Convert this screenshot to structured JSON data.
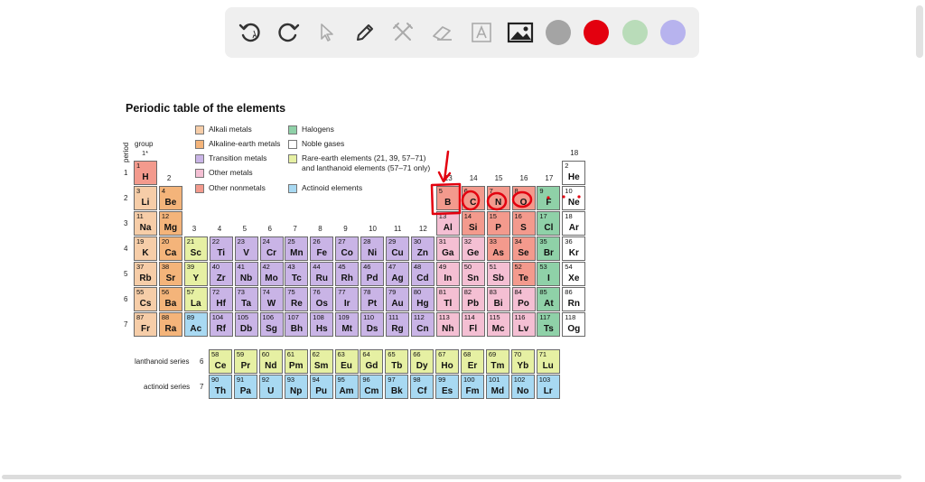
{
  "toolbar": {
    "tools": [
      {
        "name": "undo-icon"
      },
      {
        "name": "redo-icon"
      },
      {
        "name": "select-cursor-icon"
      },
      {
        "name": "pen-icon"
      },
      {
        "name": "tools-icon"
      },
      {
        "name": "eraser-icon"
      },
      {
        "name": "text-icon"
      },
      {
        "name": "image-icon"
      }
    ],
    "colors": [
      "#a4a4a4",
      "#e3000f",
      "#b9dcb9",
      "#b7b3ee"
    ]
  },
  "table": {
    "title": "Periodic table of the elements",
    "period_label": "period",
    "group_label": "group",
    "group1_label": "1*",
    "lanthanoid_label": "lanthanoid series",
    "actinoid_label": "actinoid series",
    "period6_label": "6",
    "period7_label": "7",
    "groups": [
      "1",
      "2",
      "3",
      "4",
      "5",
      "6",
      "7",
      "8",
      "9",
      "10",
      "11",
      "12",
      "13",
      "14",
      "15",
      "16",
      "17",
      "18"
    ],
    "periods": [
      "1",
      "2",
      "3",
      "4",
      "5",
      "6",
      "7"
    ],
    "legend": [
      {
        "label": "Alkali metals",
        "cls": "alkali"
      },
      {
        "label": "Alkaline-earth metals",
        "cls": "alkaline"
      },
      {
        "label": "Transition metals",
        "cls": "transition"
      },
      {
        "label": "Other metals",
        "cls": "other-metal"
      },
      {
        "label": "Other nonmetals",
        "cls": "nonmetal"
      },
      {
        "label": "Halogens",
        "cls": "halogen"
      },
      {
        "label": "Noble gases",
        "cls": "noble"
      },
      {
        "label": "Rare-earth elements (21, 39, 57–71)",
        "label2": "and lanthanoid elements (57–71 only)",
        "cls": "rare"
      },
      {
        "label": "Actinoid elements",
        "cls": "actinoid"
      }
    ],
    "elements": [
      [
        "1",
        "H",
        "nonmetal",
        1,
        1
      ],
      [
        "2",
        "He",
        "noble",
        1,
        18
      ],
      [
        "3",
        "Li",
        "alkali",
        2,
        1
      ],
      [
        "4",
        "Be",
        "alkaline",
        2,
        2
      ],
      [
        "5",
        "B",
        "nonmetal",
        2,
        13
      ],
      [
        "6",
        "C",
        "nonmetal",
        2,
        14
      ],
      [
        "7",
        "N",
        "nonmetal",
        2,
        15
      ],
      [
        "8",
        "O",
        "nonmetal",
        2,
        16
      ],
      [
        "9",
        "F",
        "halogen",
        2,
        17
      ],
      [
        "10",
        "Ne",
        "noble",
        2,
        18
      ],
      [
        "11",
        "Na",
        "alkali",
        3,
        1
      ],
      [
        "12",
        "Mg",
        "alkaline",
        3,
        2
      ],
      [
        "13",
        "Al",
        "other-metal",
        3,
        13
      ],
      [
        "14",
        "Si",
        "nonmetal",
        3,
        14
      ],
      [
        "15",
        "P",
        "nonmetal",
        3,
        15
      ],
      [
        "16",
        "S",
        "nonmetal",
        3,
        16
      ],
      [
        "17",
        "Cl",
        "halogen",
        3,
        17
      ],
      [
        "18",
        "Ar",
        "noble",
        3,
        18
      ],
      [
        "19",
        "K",
        "alkali",
        4,
        1
      ],
      [
        "20",
        "Ca",
        "alkaline",
        4,
        2
      ],
      [
        "21",
        "Sc",
        "rare",
        4,
        3
      ],
      [
        "22",
        "Ti",
        "transition",
        4,
        4
      ],
      [
        "23",
        "V",
        "transition",
        4,
        5
      ],
      [
        "24",
        "Cr",
        "transition",
        4,
        6
      ],
      [
        "25",
        "Mn",
        "transition",
        4,
        7
      ],
      [
        "26",
        "Fe",
        "transition",
        4,
        8
      ],
      [
        "27",
        "Co",
        "transition",
        4,
        9
      ],
      [
        "28",
        "Ni",
        "transition",
        4,
        10
      ],
      [
        "29",
        "Cu",
        "transition",
        4,
        11
      ],
      [
        "30",
        "Zn",
        "transition",
        4,
        12
      ],
      [
        "31",
        "Ga",
        "other-metal",
        4,
        13
      ],
      [
        "32",
        "Ge",
        "other-metal",
        4,
        14
      ],
      [
        "33",
        "As",
        "nonmetal",
        4,
        15
      ],
      [
        "34",
        "Se",
        "nonmetal",
        4,
        16
      ],
      [
        "35",
        "Br",
        "halogen",
        4,
        17
      ],
      [
        "36",
        "Kr",
        "noble",
        4,
        18
      ],
      [
        "37",
        "Rb",
        "alkali",
        5,
        1
      ],
      [
        "38",
        "Sr",
        "alkaline",
        5,
        2
      ],
      [
        "39",
        "Y",
        "rare",
        5,
        3
      ],
      [
        "40",
        "Zr",
        "transition",
        5,
        4
      ],
      [
        "41",
        "Nb",
        "transition",
        5,
        5
      ],
      [
        "42",
        "Mo",
        "transition",
        5,
        6
      ],
      [
        "43",
        "Tc",
        "transition",
        5,
        7
      ],
      [
        "44",
        "Ru",
        "transition",
        5,
        8
      ],
      [
        "45",
        "Rh",
        "transition",
        5,
        9
      ],
      [
        "46",
        "Pd",
        "transition",
        5,
        10
      ],
      [
        "47",
        "Ag",
        "transition",
        5,
        11
      ],
      [
        "48",
        "Cd",
        "transition",
        5,
        12
      ],
      [
        "49",
        "In",
        "other-metal",
        5,
        13
      ],
      [
        "50",
        "Sn",
        "other-metal",
        5,
        14
      ],
      [
        "51",
        "Sb",
        "other-metal",
        5,
        15
      ],
      [
        "52",
        "Te",
        "nonmetal",
        5,
        16
      ],
      [
        "53",
        "I",
        "halogen",
        5,
        17
      ],
      [
        "54",
        "Xe",
        "noble",
        5,
        18
      ],
      [
        "55",
        "Cs",
        "alkali",
        6,
        1
      ],
      [
        "56",
        "Ba",
        "alkaline",
        6,
        2
      ],
      [
        "57",
        "La",
        "rare",
        6,
        3
      ],
      [
        "72",
        "Hf",
        "transition",
        6,
        4
      ],
      [
        "73",
        "Ta",
        "transition",
        6,
        5
      ],
      [
        "74",
        "W",
        "transition",
        6,
        6
      ],
      [
        "75",
        "Re",
        "transition",
        6,
        7
      ],
      [
        "76",
        "Os",
        "transition",
        6,
        8
      ],
      [
        "77",
        "Ir",
        "transition",
        6,
        9
      ],
      [
        "78",
        "Pt",
        "transition",
        6,
        10
      ],
      [
        "79",
        "Au",
        "transition",
        6,
        11
      ],
      [
        "80",
        "Hg",
        "transition",
        6,
        12
      ],
      [
        "81",
        "Tl",
        "other-metal",
        6,
        13
      ],
      [
        "82",
        "Pb",
        "other-metal",
        6,
        14
      ],
      [
        "83",
        "Bi",
        "other-metal",
        6,
        15
      ],
      [
        "84",
        "Po",
        "other-metal",
        6,
        16
      ],
      [
        "85",
        "At",
        "halogen",
        6,
        17
      ],
      [
        "86",
        "Rn",
        "noble",
        6,
        18
      ],
      [
        "87",
        "Fr",
        "alkali",
        7,
        1
      ],
      [
        "88",
        "Ra",
        "alkaline",
        7,
        2
      ],
      [
        "89",
        "Ac",
        "actinoid",
        7,
        3
      ],
      [
        "104",
        "Rf",
        "transition",
        7,
        4
      ],
      [
        "105",
        "Db",
        "transition",
        7,
        5
      ],
      [
        "106",
        "Sg",
        "transition",
        7,
        6
      ],
      [
        "107",
        "Bh",
        "transition",
        7,
        7
      ],
      [
        "108",
        "Hs",
        "transition",
        7,
        8
      ],
      [
        "109",
        "Mt",
        "transition",
        7,
        9
      ],
      [
        "110",
        "Ds",
        "transition",
        7,
        10
      ],
      [
        "111",
        "Rg",
        "transition",
        7,
        11
      ],
      [
        "112",
        "Cn",
        "transition",
        7,
        12
      ],
      [
        "113",
        "Nh",
        "other-metal",
        7,
        13
      ],
      [
        "114",
        "Fl",
        "other-metal",
        7,
        14
      ],
      [
        "115",
        "Mc",
        "other-metal",
        7,
        15
      ],
      [
        "116",
        "Lv",
        "other-metal",
        7,
        16
      ],
      [
        "117",
        "Ts",
        "halogen",
        7,
        17
      ],
      [
        "118",
        "Og",
        "noble",
        7,
        18
      ]
    ],
    "lanthanoids": [
      [
        "58",
        "Ce"
      ],
      [
        "59",
        "Pr"
      ],
      [
        "60",
        "Nd"
      ],
      [
        "61",
        "Pm"
      ],
      [
        "62",
        "Sm"
      ],
      [
        "63",
        "Eu"
      ],
      [
        "64",
        "Gd"
      ],
      [
        "65",
        "Tb"
      ],
      [
        "66",
        "Dy"
      ],
      [
        "67",
        "Ho"
      ],
      [
        "68",
        "Er"
      ],
      [
        "69",
        "Tm"
      ],
      [
        "70",
        "Yb"
      ],
      [
        "71",
        "Lu"
      ]
    ],
    "actinoids": [
      [
        "90",
        "Th"
      ],
      [
        "91",
        "Pa"
      ],
      [
        "92",
        "U"
      ],
      [
        "93",
        "Np"
      ],
      [
        "94",
        "Pu"
      ],
      [
        "95",
        "Am"
      ],
      [
        "96",
        "Cm"
      ],
      [
        "97",
        "Bk"
      ],
      [
        "98",
        "Cf"
      ],
      [
        "99",
        "Es"
      ],
      [
        "100",
        "Fm"
      ],
      [
        "101",
        "Md"
      ],
      [
        "102",
        "No"
      ],
      [
        "103",
        "Lr"
      ]
    ]
  },
  "annotations": {
    "color": "#e3000f",
    "circled": [
      "B",
      "C",
      "N",
      "O"
    ]
  }
}
